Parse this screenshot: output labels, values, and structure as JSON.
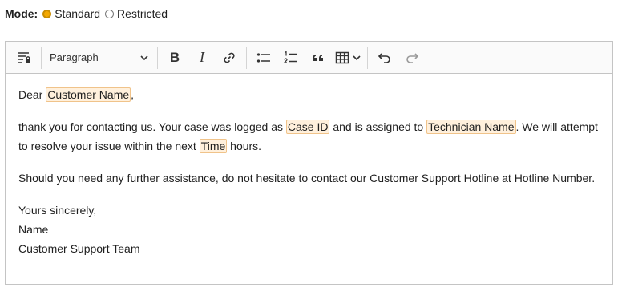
{
  "mode": {
    "label": "Mode:",
    "options": [
      {
        "label": "Standard",
        "checked": true
      },
      {
        "label": "Restricted",
        "checked": false
      }
    ]
  },
  "toolbar": {
    "paragraph_dropdown": "Paragraph",
    "icons": [
      "restricted-editing-icon",
      "bold-icon",
      "italic-icon",
      "link-icon",
      "bulleted-list-icon",
      "numbered-list-icon",
      "block-quote-icon",
      "insert-table-icon",
      "undo-icon",
      "redo-icon"
    ],
    "bold_glyph": "B",
    "italic_glyph": "I"
  },
  "content": {
    "greeting_prefix": "Dear ",
    "customer_name": "Customer Name",
    "greeting_suffix": ",",
    "p2_a": "thank you for contacting us. Your case was logged as ",
    "case_id": "Case ID",
    "p2_b": " and is assigned to ",
    "technician_name": "Technician Name",
    "p2_c": ". We will attempt to resolve your issue within the next ",
    "time": "Time",
    "p2_d": " hours.",
    "p3": "Should you need any further assistance, do not hesitate to contact our Customer Support Hotline at Hotline Number.",
    "closing": "Yours sincerely,",
    "name": "Name",
    "team": "Customer Support Team"
  },
  "colors": {
    "radio_accent": "#f3a800",
    "placeholder_bg": "#fff0dc",
    "placeholder_border": "#f0c38a"
  }
}
